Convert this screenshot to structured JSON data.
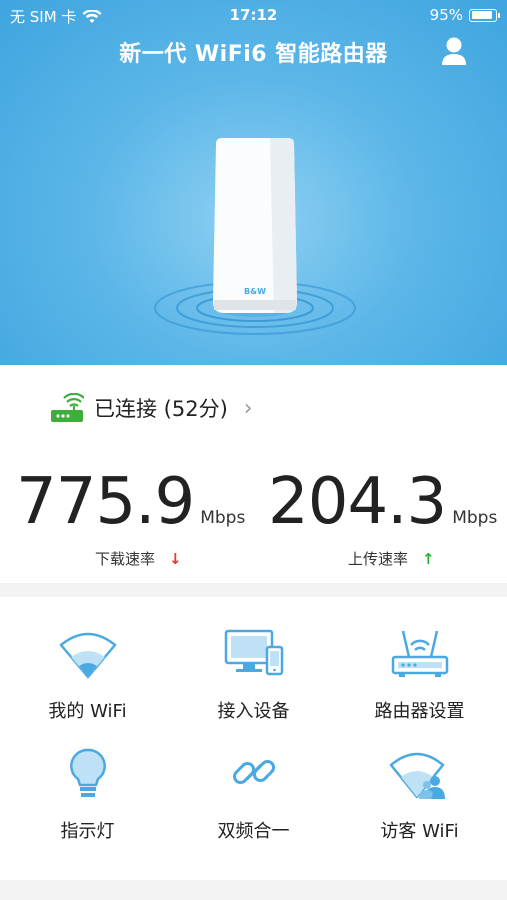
{
  "status_bar": {
    "carrier": "无 SIM 卡",
    "time": "17:12",
    "battery": "95%"
  },
  "header": {
    "title": "新一代 WiFi6 智能路由器"
  },
  "device": {
    "brand": "B&W"
  },
  "connection": {
    "status": "已连接 (52分)"
  },
  "speeds": {
    "download": {
      "value": "775.9",
      "unit": "Mbps",
      "label": "下载速率"
    },
    "upload": {
      "value": "204.3",
      "unit": "Mbps",
      "label": "上传速率"
    }
  },
  "features": [
    {
      "label": "我的 WiFi",
      "icon": "wifi-icon"
    },
    {
      "label": "接入设备",
      "icon": "devices-icon"
    },
    {
      "label": "路由器设置",
      "icon": "router-settings-icon"
    },
    {
      "label": "指示灯",
      "icon": "lightbulb-icon"
    },
    {
      "label": "双频合一",
      "icon": "link-icon"
    },
    {
      "label": "访客 WiFi",
      "icon": "guest-wifi-icon"
    }
  ],
  "colors": {
    "accent": "#4aa9e0",
    "download_arrow": "#e03a2f",
    "upload_arrow": "#2fae3c",
    "router_icon": "#3dae3c"
  }
}
